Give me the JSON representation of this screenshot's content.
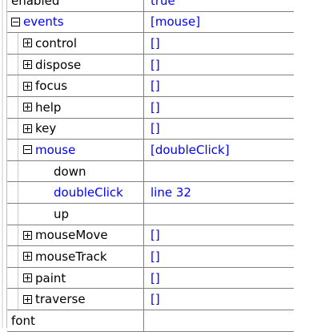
{
  "properties": {
    "rows": [
      {
        "key": "enabled",
        "value": "true",
        "level": 0,
        "toggle": "none",
        "key_color": "black",
        "value_color": "blue"
      },
      {
        "key": "events",
        "value": "[mouse]",
        "level": 0,
        "toggle": "minus",
        "key_color": "blue",
        "value_color": "blue"
      },
      {
        "key": "control",
        "value": "[]",
        "level": 1,
        "toggle": "plus",
        "key_color": "black",
        "value_color": "blue"
      },
      {
        "key": "dispose",
        "value": "[]",
        "level": 1,
        "toggle": "plus",
        "key_color": "black",
        "value_color": "blue"
      },
      {
        "key": "focus",
        "value": "[]",
        "level": 1,
        "toggle": "plus",
        "key_color": "black",
        "value_color": "blue"
      },
      {
        "key": "help",
        "value": "[]",
        "level": 1,
        "toggle": "plus",
        "key_color": "black",
        "value_color": "blue"
      },
      {
        "key": "key",
        "value": "[]",
        "level": 1,
        "toggle": "plus",
        "key_color": "black",
        "value_color": "blue"
      },
      {
        "key": "mouse",
        "value": "[doubleClick]",
        "level": 1,
        "toggle": "minus",
        "key_color": "blue",
        "value_color": "blue"
      },
      {
        "key": "down",
        "value": "",
        "level": 2,
        "toggle": "none",
        "key_color": "black",
        "value_color": "blue"
      },
      {
        "key": "doubleClick",
        "value": "line 32",
        "level": 2,
        "toggle": "none",
        "key_color": "blue",
        "value_color": "blue"
      },
      {
        "key": "up",
        "value": "",
        "level": 2,
        "toggle": "none",
        "key_color": "black",
        "value_color": "blue"
      },
      {
        "key": "mouseMove",
        "value": "[]",
        "level": 1,
        "toggle": "plus",
        "key_color": "black",
        "value_color": "blue"
      },
      {
        "key": "mouseTrack",
        "value": "[]",
        "level": 1,
        "toggle": "plus",
        "key_color": "black",
        "value_color": "blue"
      },
      {
        "key": "paint",
        "value": "[]",
        "level": 1,
        "toggle": "plus",
        "key_color": "black",
        "value_color": "blue"
      },
      {
        "key": "traverse",
        "value": "[]",
        "level": 1,
        "toggle": "plus",
        "key_color": "black",
        "value_color": "blue"
      },
      {
        "key": "font",
        "value": "",
        "level": 0,
        "toggle": "none",
        "key_color": "black",
        "value_color": "blue"
      }
    ]
  },
  "colors": {
    "blue": "#0000ff",
    "black": "#000000",
    "grid": "#808080"
  },
  "icons": {
    "expand": "plus-box-icon",
    "collapse": "minus-box-icon"
  }
}
